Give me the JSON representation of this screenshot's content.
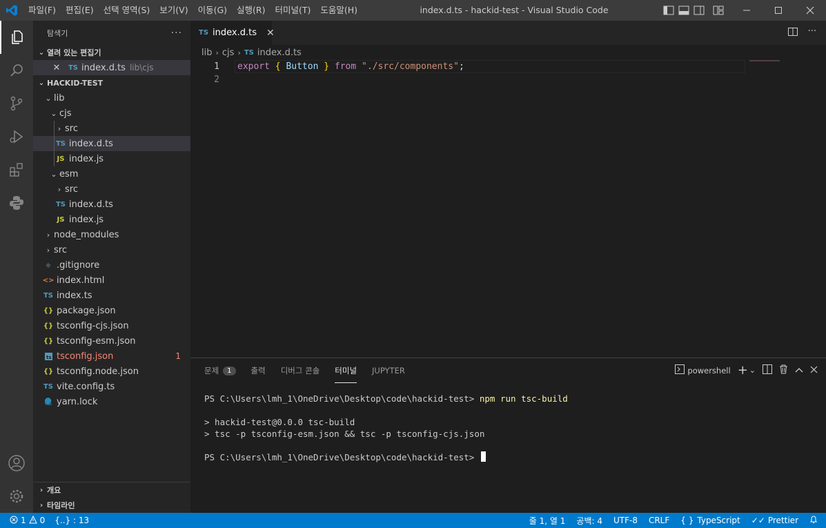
{
  "titlebar": {
    "menu": [
      "파일(F)",
      "편집(E)",
      "선택 영역(S)",
      "보기(V)",
      "이동(G)",
      "실행(R)",
      "터미널(T)",
      "도움말(H)"
    ],
    "title": "index.d.ts - hackid-test - Visual Studio Code",
    "accent": "#3c3c3c"
  },
  "sidebar": {
    "header": "탐색기",
    "more": "···",
    "open_editors": {
      "title": "열려 있는 편집기",
      "items": [
        {
          "icon": "TS",
          "name": "index.d.ts",
          "path": "lib\\cjs"
        }
      ]
    },
    "project": {
      "title": "HACKID-TEST",
      "tree": [
        {
          "label": "lib"
        },
        {
          "label": "cjs"
        },
        {
          "label": "src"
        },
        {
          "icon": "TS",
          "label": "index.d.ts"
        },
        {
          "icon": "JS",
          "label": "index.js"
        },
        {
          "label": "esm"
        },
        {
          "label": "src"
        },
        {
          "icon": "TS",
          "label": "index.d.ts"
        },
        {
          "icon": "JS",
          "label": "index.js"
        },
        {
          "label": "node_modules"
        },
        {
          "label": "src"
        },
        {
          "label": ".gitignore"
        },
        {
          "icon": "<>",
          "label": "index.html"
        },
        {
          "icon": "TS",
          "label": "index.ts"
        },
        {
          "icon": "{}",
          "label": "package.json"
        },
        {
          "icon": "{}",
          "label": "tsconfig-cjs.json"
        },
        {
          "icon": "{}",
          "label": "tsconfig-esm.json"
        },
        {
          "label": "tsconfig.json",
          "errors": "1"
        },
        {
          "icon": "{}",
          "label": "tsconfig.node.json"
        },
        {
          "icon": "TS",
          "label": "vite.config.ts"
        },
        {
          "label": "yarn.lock"
        }
      ]
    },
    "bottom": {
      "outline": "개요",
      "timeline": "타임라인"
    }
  },
  "editor": {
    "tab": {
      "icon": "TS",
      "label": "index.d.ts",
      "close": "✕"
    },
    "breadcrumb": [
      "lib",
      "cjs",
      "index.d.ts"
    ],
    "breadcrumb_icon": "TS",
    "lines": [
      {
        "num": "1",
        "tokens": {
          "k1": "export",
          "b1": "{",
          "v1": "Button",
          "b2": "}",
          "k2": "from",
          "s1": "\"./src/components\"",
          "p1": ";"
        }
      },
      {
        "num": "2"
      }
    ]
  },
  "panel": {
    "tabs": [
      "문제",
      "출력",
      "디버그 콘솔",
      "터미널",
      "JUPYTER"
    ],
    "problem_count": "1",
    "active_tab": "터미널",
    "shell": "powershell",
    "terminal": {
      "prompt1": "PS C:\\Users\\lmh_1\\OneDrive\\Desktop\\code\\hackid-test>",
      "command": "npm run tsc-build",
      "out1": "> hackid-test@0.0.0 tsc-build",
      "out2": "> tsc -p tsconfig-esm.json && tsc -p tsconfig-cjs.json",
      "prompt2": "PS C:\\Users\\lmh_1\\OneDrive\\Desktop\\code\\hackid-test>"
    }
  },
  "statusbar": {
    "errors": "1",
    "warnings": "0",
    "json_symbols": "{..} : 13",
    "position": "줄 1, 열 1",
    "spaces": "공백: 4",
    "encoding": "UTF-8",
    "eol": "CRLF",
    "language": "TypeScript",
    "formatter": "Prettier",
    "color": "#007acc"
  }
}
